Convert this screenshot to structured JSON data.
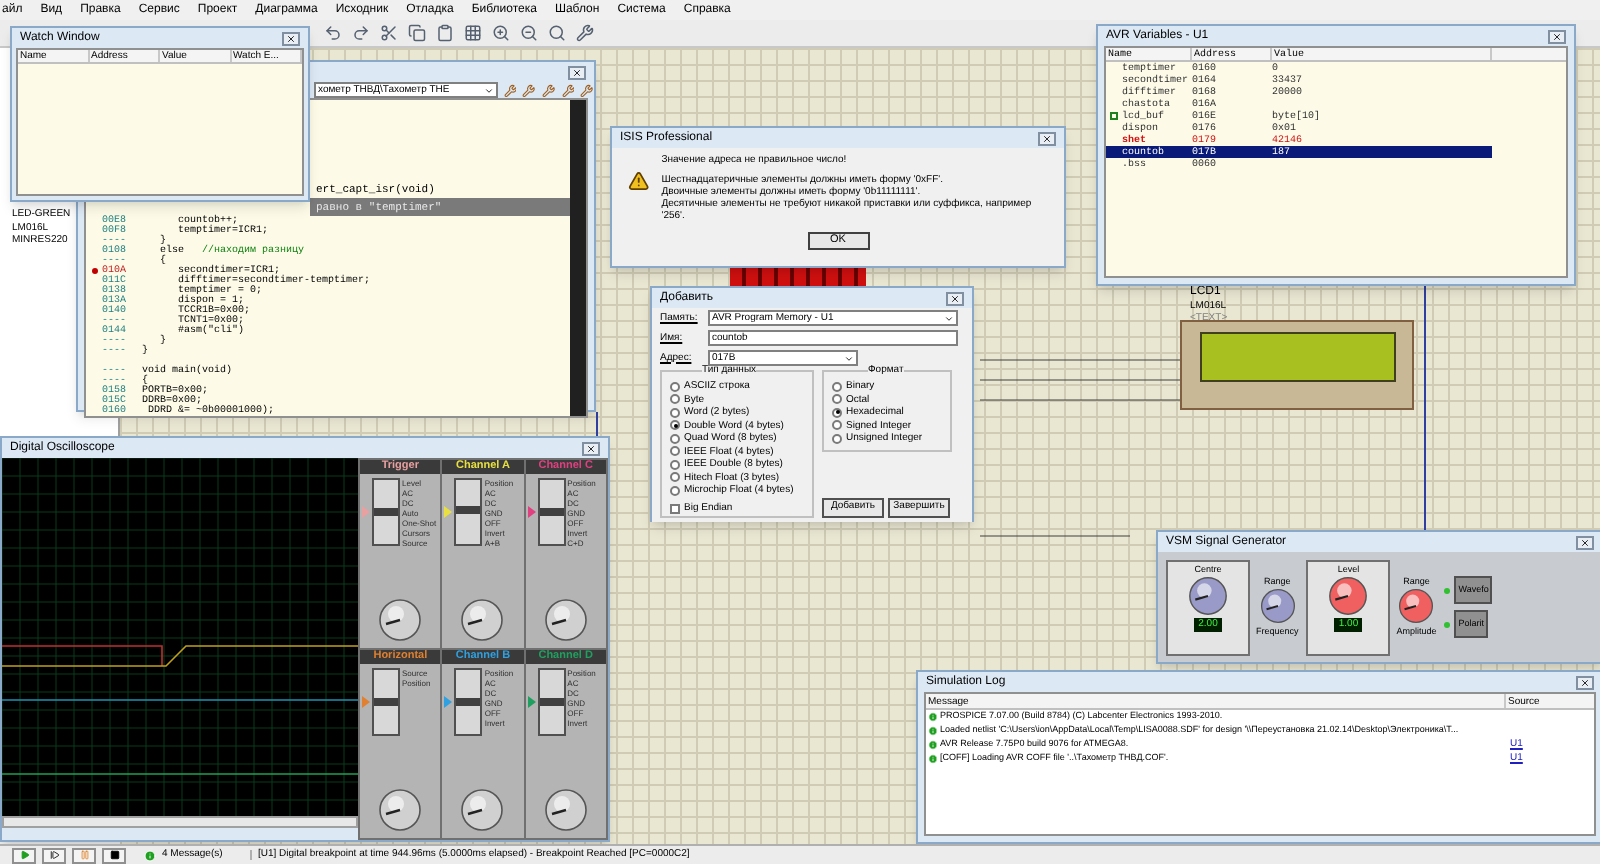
{
  "menu": [
    "айл",
    "Вид",
    "Правка",
    "Сервис",
    "Проект",
    "Диаграмма",
    "Исходник",
    "Отладка",
    "Библиотека",
    "Шаблон",
    "Система",
    "Справка"
  ],
  "sidebar": {
    "items": [
      "LED-GREEN",
      "LM016L",
      "MINRES220"
    ]
  },
  "schematic": {
    "lcd": {
      "ref": "LCD1",
      "model": "LM016L",
      "text": "<TEXT>"
    }
  },
  "watch_window": {
    "title": "Watch Window",
    "columns": [
      "Name",
      "Address",
      "Value",
      "Watch E..."
    ]
  },
  "source_window": {
    "file": "хометр ТНВД\\Тахометр ТНЕ",
    "lines": [
      {
        "kind": "fragment",
        "code": "ert_capt_isr(void)",
        "current": false
      },
      {
        "kind": "fragment",
        "code": "равно в \"temptimer\"",
        "current": true
      },
      {
        "kind": "line",
        "address": "00E8",
        "code": "      countob++;",
        "current": false,
        "breakpoint": false
      },
      {
        "kind": "line",
        "address": "00F8",
        "code": "      temptimer=ICR1;",
        "current": false,
        "breakpoint": false
      },
      {
        "kind": "line",
        "address": "----",
        "code": "   }",
        "current": false,
        "breakpoint": false
      },
      {
        "kind": "line",
        "address": "0108",
        "code": "   else",
        "comment": "   //находим разницу",
        "current": false,
        "breakpoint": false
      },
      {
        "kind": "line",
        "address": "----",
        "code": "   {",
        "current": false,
        "breakpoint": false
      },
      {
        "kind": "line",
        "address": "010A",
        "code": "      secondtimer=ICR1;",
        "current": false,
        "breakpoint": true
      },
      {
        "kind": "line",
        "address": "011C",
        "code": "      difftimer=secondtimer-temptimer;",
        "current": false,
        "breakpoint": false
      },
      {
        "kind": "line",
        "address": "0138",
        "code": "      temptimer = 0;",
        "current": false,
        "breakpoint": false
      },
      {
        "kind": "line",
        "address": "013A",
        "code": "      dispon = 1;",
        "current": false,
        "breakpoint": false
      },
      {
        "kind": "line",
        "address": "0140",
        "code": "      TCCR1B=0x00;",
        "current": false,
        "breakpoint": false
      },
      {
        "kind": "line",
        "address": "----",
        "code": "      TCNT1=0x00;",
        "current": false,
        "breakpoint": false
      },
      {
        "kind": "line",
        "address": "0144",
        "code": "      #asm(\"cli\")",
        "current": false,
        "breakpoint": false
      },
      {
        "kind": "line",
        "address": "----",
        "code": "   }",
        "current": false,
        "breakpoint": false
      },
      {
        "kind": "line",
        "address": "----",
        "code": "}",
        "current": false,
        "breakpoint": false
      },
      {
        "kind": "blank"
      },
      {
        "kind": "line",
        "address": "----",
        "code": "void main(void)",
        "current": false,
        "breakpoint": false
      },
      {
        "kind": "line",
        "address": "----",
        "code": "{",
        "current": false,
        "breakpoint": false
      },
      {
        "kind": "line",
        "address": "0158",
        "code": "PORTB=0x00;",
        "current": false,
        "breakpoint": false
      },
      {
        "kind": "line",
        "address": "015C",
        "code": "DDRB=0x00;",
        "current": false,
        "breakpoint": false
      },
      {
        "kind": "line",
        "address": "0160",
        "code": " DDRD &= ~0b00001000);",
        "current": false,
        "breakpoint": false
      }
    ]
  },
  "error_dialog": {
    "title": "ISIS Professional",
    "heading": "Значение адреса не правильное число!",
    "lines": [
      "Шестнадцатеричные элементы должны иметь форму '0xFF'.",
      "Двоичные элементы должны иметь форму '0b11111111'.",
      "Десятичные элементы не требуют никакой приставки или суффикса, например '256'."
    ],
    "button": "OK"
  },
  "avr_variables": {
    "title": "AVR Variables - U1",
    "columns": [
      "Name",
      "Address",
      "Value"
    ],
    "rows": [
      {
        "name": "temptimer",
        "address": "0160",
        "value": "0",
        "expandable": false,
        "changed": false,
        "selected": false
      },
      {
        "name": "secondtimer",
        "address": "0164",
        "value": "33437",
        "expandable": false,
        "changed": false,
        "selected": false
      },
      {
        "name": "difftimer",
        "address": "0168",
        "value": "20000",
        "expandable": false,
        "changed": false,
        "selected": false
      },
      {
        "name": "chastota",
        "address": "016A",
        "expandable": false,
        "changed": false,
        "selected": false
      },
      {
        "name": "lcd_buf",
        "address": "016E",
        "value": "byte[10]",
        "expandable": true,
        "changed": false,
        "selected": false
      },
      {
        "name": "dispon",
        "address": "0176",
        "value": "0x01",
        "expandable": false,
        "changed": false,
        "selected": false
      },
      {
        "name": "shet",
        "address": "0179",
        "value": "42146",
        "expandable": false,
        "changed": true,
        "selected": false
      },
      {
        "name": "countob",
        "address": "017B",
        "value": "187",
        "expandable": false,
        "changed": false,
        "selected": true
      },
      {
        "name": ".bss",
        "address": "0060",
        "expandable": false,
        "changed": false,
        "selected": false
      }
    ]
  },
  "add_dialog": {
    "title": "Добавить",
    "memory_label": "Память:",
    "memory": "AVR Program Memory - U1",
    "name_label": "Имя:",
    "name": "countob",
    "address_label": "Адрес:",
    "address": "017B",
    "type_group": "Тип данных",
    "types": [
      {
        "label": "ASCIIZ строка",
        "selected": false
      },
      {
        "label": "Byte",
        "selected": false
      },
      {
        "label": "Word (2 bytes)",
        "selected": false
      },
      {
        "label": "Double Word (4 bytes)",
        "selected": true
      },
      {
        "label": "Quad Word (8 bytes)",
        "selected": false
      },
      {
        "label": "IEEE Float (4 bytes)",
        "selected": false
      },
      {
        "label": "IEEE Double (8 bytes)",
        "selected": false
      },
      {
        "label": "Hitech Float (3 bytes)",
        "selected": false
      },
      {
        "label": "Microchip Float (4 bytes)",
        "selected": false
      }
    ],
    "big_endian": {
      "label": "Big Endian",
      "checked": false
    },
    "format_group": "Формат",
    "formats": [
      {
        "label": "Binary",
        "selected": false
      },
      {
        "label": "Octal",
        "selected": false
      },
      {
        "label": "Hexadecimal",
        "selected": true
      },
      {
        "label": "Signed Integer",
        "selected": false
      },
      {
        "label": "Unsigned Integer",
        "selected": false
      }
    ],
    "buttons": [
      "Добавить",
      "Завершить"
    ]
  },
  "oscilloscope": {
    "title": "Digital Oscilloscope",
    "panels": [
      {
        "title": "Trigger",
        "color": "#e8a0a0",
        "level": 0.5,
        "labels": [
          "Level",
          "AC",
          "DC",
          "Auto",
          "One-Shot",
          "Cursors",
          "Source"
        ]
      },
      {
        "title": "Channel A",
        "color": "#e8e040",
        "level": 0.55,
        "labels": [
          "Position",
          "AC",
          "DC",
          "GND",
          "OFF",
          "Invert",
          "A+B"
        ]
      },
      {
        "title": "Channel C",
        "color": "#e04080",
        "level": 0.5,
        "labels": [
          "Position",
          "AC",
          "DC",
          "GND",
          "OFF",
          "Invert",
          "C+D"
        ]
      },
      {
        "title": "Horizontal",
        "color": "#e08030",
        "level": 0.5,
        "labels": [
          "Source",
          "Position"
        ]
      },
      {
        "title": "Channel B",
        "color": "#30a0e0",
        "level": 0.5,
        "labels": [
          "Position",
          "AC",
          "DC",
          "GND",
          "OFF",
          "Invert"
        ]
      },
      {
        "title": "Channel D",
        "color": "#20a060",
        "level": 0.5,
        "labels": [
          "Position",
          "AC",
          "DC",
          "GND",
          "OFF",
          "Invert"
        ]
      }
    ]
  },
  "signal_generator": {
    "title": "VSM Signal Generator",
    "sections": [
      {
        "kind": "frequency",
        "dial_label": "Centre",
        "range_label": "Range",
        "caption": "Frequency",
        "display": "2.00"
      },
      {
        "kind": "amplitude",
        "dial_label": "Level",
        "range_label": "Range",
        "caption": "Amplitude",
        "display": "1.00"
      }
    ],
    "buttons": [
      "Wavefo",
      "Polarit"
    ]
  },
  "simulation_log": {
    "title": "Simulation Log",
    "columns": [
      "Message",
      "Source"
    ],
    "rows": [
      {
        "message": "PROSPICE 7.07.00 (Build 8784) (C) Labcenter Electronics 1993-2010."
      },
      {
        "message": "Loaded netlist 'C:\\Users\\ion\\AppData\\Local\\Temp\\LISA0088.SDF' for design '\\\\Переустановка 21.02.14\\Desktop\\Электроника\\T..."
      },
      {
        "message": "AVR Release 7.75P0 build 9076 for ATMEGA8.",
        "source": "U1"
      },
      {
        "message": "[COFF] Loading AVR COFF file '..\\Тахометр ТНВД.COF'.",
        "source": "U1"
      }
    ]
  },
  "status_bar": {
    "messages": "4 Message(s)",
    "text": "[U1] Digital breakpoint at time 944.96ms (5.0000ms elapsed) - Breakpoint Reached [PC=0000C2]"
  }
}
